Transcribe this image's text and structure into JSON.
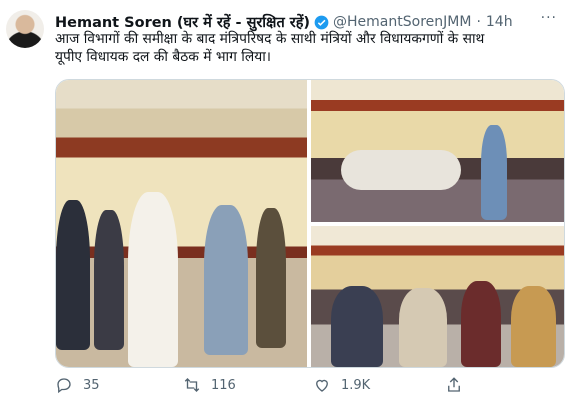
{
  "tweet": {
    "author_name": "Hemant Soren (घर में रहें - सुरक्षित रहें)",
    "handle": "@HemantSorenJMM",
    "separator": "·",
    "time": "14h",
    "more_label": "···",
    "text_line1": "आज विभागों की समीक्षा के बाद मंत्रिपरिषद के साथी मंत्रियों और विधायकगणों के साथ",
    "text_line2": "यूपीए विधायक दल की बैठक में भाग लिया।"
  },
  "actions": {
    "reply_count": "35",
    "retweet_count": "116",
    "like_count": "1.9K",
    "icons": [
      "reply-icon",
      "retweet-icon",
      "like-icon",
      "share-icon"
    ]
  },
  "colors": {
    "verified": "#1d9bf0",
    "secondary_text": "#536471",
    "border": "#cfd9de"
  }
}
